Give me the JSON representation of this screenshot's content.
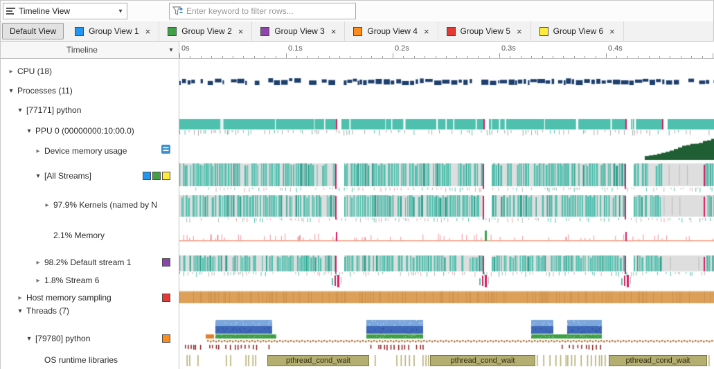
{
  "toolbar": {
    "view_selector": "Timeline View",
    "filter_placeholder": "Enter keyword to filter rows..."
  },
  "glyphs": {
    "dropdown": "▾",
    "collapsed": "▸",
    "expanded": "▾",
    "close": "×"
  },
  "tabs": {
    "default": "Default View",
    "groups": [
      {
        "label": "Group View 1",
        "color": "#2196f3"
      },
      {
        "label": "Group View 2",
        "color": "#43a047"
      },
      {
        "label": "Group View 3",
        "color": "#8e44ad"
      },
      {
        "label": "Group View 4",
        "color": "#ff8c1a"
      },
      {
        "label": "Group View 5",
        "color": "#e53935"
      },
      {
        "label": "Group View 6",
        "color": "#ffeb3b"
      }
    ]
  },
  "timeline_header": {
    "column_label": "Timeline",
    "ticks": [
      "0s",
      "0.1s",
      "0.2s",
      "0.3s",
      "0.4s"
    ]
  },
  "tree": [
    {
      "label": "CPU (18)",
      "level": 0,
      "expander": "collapsed"
    },
    {
      "label": "Processes (11)",
      "level": 0,
      "expander": "expanded"
    },
    {
      "label": "[77171] python",
      "level": 1,
      "expander": "expanded"
    },
    {
      "label": "PPU 0 (00000000:10:00.0)",
      "level": 2,
      "expander": "expanded"
    },
    {
      "label": "Device memory usage",
      "level": 3,
      "expander": "collapsed",
      "icon": "device-memory-badge"
    },
    {
      "label": "[All Streams]",
      "level": 3,
      "expander": "expanded",
      "swatches": [
        "#2196f3",
        "#43a047",
        "#ffeb3b"
      ]
    },
    {
      "label": "97.9% Kernels (named by N",
      "level": 4,
      "expander": "collapsed"
    },
    {
      "label": "2.1% Memory",
      "level": 4,
      "expander": "none"
    },
    {
      "label": "98.2% Default stream 1",
      "level": 3,
      "expander": "collapsed",
      "swatches": [
        "#8e44ad"
      ]
    },
    {
      "label": "1.8% Stream 6",
      "level": 3,
      "expander": "collapsed"
    },
    {
      "label": "Host memory sampling",
      "level": 1,
      "expander": "collapsed",
      "swatches": [
        "#e53935"
      ]
    },
    {
      "label": "Threads (7)",
      "level": 1,
      "expander": "expanded"
    },
    {
      "label": "[79780] python",
      "level": 2,
      "expander": "expanded",
      "swatches": [
        "#ff8c1a"
      ]
    },
    {
      "label": "OS runtime libraries",
      "level": 3,
      "expander": "none"
    }
  ],
  "timeline": {
    "os_runtime_labels": [
      "pthread_cond_wait",
      "pthread_cond_wait",
      "pthread_cond_wait"
    ]
  },
  "colors": {
    "teal": "#4fc0ae",
    "teal_dark": "#2e9e8e",
    "row_bg": "#dedede",
    "magenta": "#d81b60",
    "pink_light": "#f2a3ad",
    "cpu_blue": "#1d3f6e",
    "mem_green": "#1f5f33",
    "host_orange": "#dda058",
    "thread_blue_top": "#7ba7dd",
    "thread_blue_bottom": "#4068b8",
    "thread_green": "#3fa047",
    "runtime_olive": "#b4ae70",
    "dotted_brown": "#b5763d",
    "tick_red": "#8b1a1a",
    "salmon": "#f0a088",
    "orange_seg": "#e08030",
    "green_tick": "#3fa047"
  }
}
